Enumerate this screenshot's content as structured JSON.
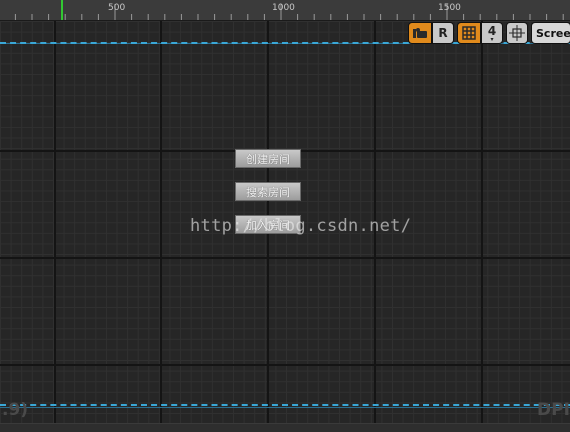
{
  "ruler": {
    "labels": [
      "500",
      "1000",
      "1500"
    ]
  },
  "toolbar": {
    "camera_icon": "camera-icon",
    "r_label": "R",
    "grid_icon": "grid-icon",
    "grid_size": "4",
    "transform_icon": "transform-icon",
    "screen_label": "Screen"
  },
  "menu": {
    "buttons": [
      "创建房间",
      "搜索房间",
      "加入房间"
    ]
  },
  "watermark": "http://blog.csdn.net/",
  "corners": {
    "left": ".9)",
    "right": "DPI"
  },
  "colors": {
    "accent": "#e08a1c",
    "safe_zone": "#3aa7d6",
    "playhead": "#32c832"
  }
}
